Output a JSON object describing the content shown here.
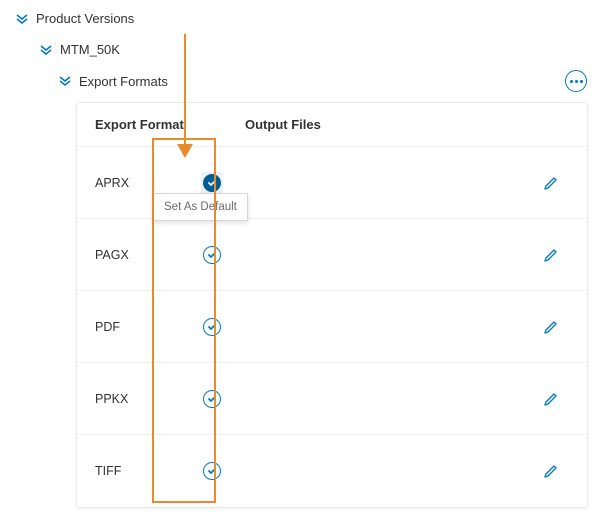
{
  "colors": {
    "accent": "#0079c1",
    "accent_dark": "#005e95",
    "callout": "#e78b2c"
  },
  "tree": {
    "root_label": "Product Versions",
    "child_label": "MTM_50K",
    "grandchild_label": "Export Formats"
  },
  "more_button_name": "more-actions",
  "table": {
    "headers": {
      "format": "Export Format",
      "output": "Output Files"
    },
    "rows": [
      {
        "format": "APRX",
        "default": true,
        "tooltip": "Set As Default"
      },
      {
        "format": "PAGX",
        "default": false
      },
      {
        "format": "PDF",
        "default": false
      },
      {
        "format": "PPKX",
        "default": false
      },
      {
        "format": "TIFF",
        "default": false
      }
    ]
  }
}
